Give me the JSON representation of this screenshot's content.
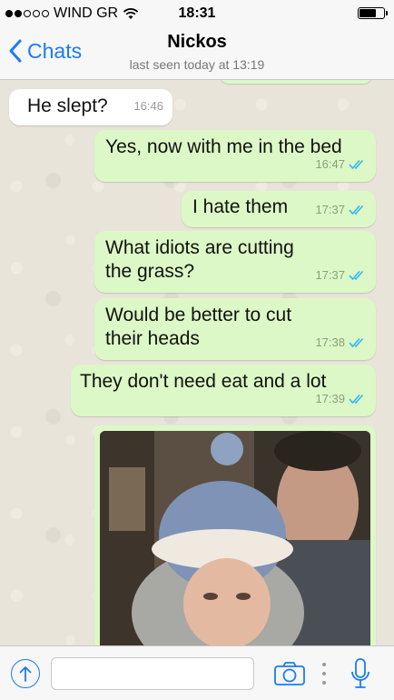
{
  "status_bar": {
    "carrier": "WIND GR",
    "time": "18:31",
    "signal_bars_filled": 2,
    "signal_bars_total": 5,
    "battery_level": 0.7
  },
  "header": {
    "back_label": "Chats",
    "contact_name": "Nickos",
    "last_seen": "last seen today at 13:19"
  },
  "messages": [
    {
      "direction": "in",
      "text": "He slept?",
      "time": "16:46",
      "read": false
    },
    {
      "direction": "out",
      "text": "Yes, now with me in the bed",
      "time": "16:47",
      "read": true
    },
    {
      "direction": "out",
      "text": "I hate them",
      "time": "17:37",
      "read": true
    },
    {
      "direction": "out",
      "text": "What idiots are cutting the grass?",
      "time": "17:37",
      "read": true
    },
    {
      "direction": "out",
      "text": "Would be better to cut their heads",
      "time": "17:38",
      "read": true
    },
    {
      "direction": "out",
      "text": "They don't need eat and a lot",
      "time": "17:39",
      "read": true
    }
  ],
  "photo_message": {
    "direction": "out",
    "icon": "photo-icon"
  },
  "input_bar": {
    "placeholder": "",
    "value": "",
    "share_icon": "share-icon",
    "camera_icon": "camera-icon",
    "more_icon": "more-icon",
    "mic_icon": "microphone-icon"
  },
  "colors": {
    "accent": "#1a7cf4",
    "outgoing_bubble": "#dcf8c6",
    "incoming_bubble": "#ffffff",
    "read_ticks": "#34b7f1",
    "chat_background": "#e8e4da"
  }
}
